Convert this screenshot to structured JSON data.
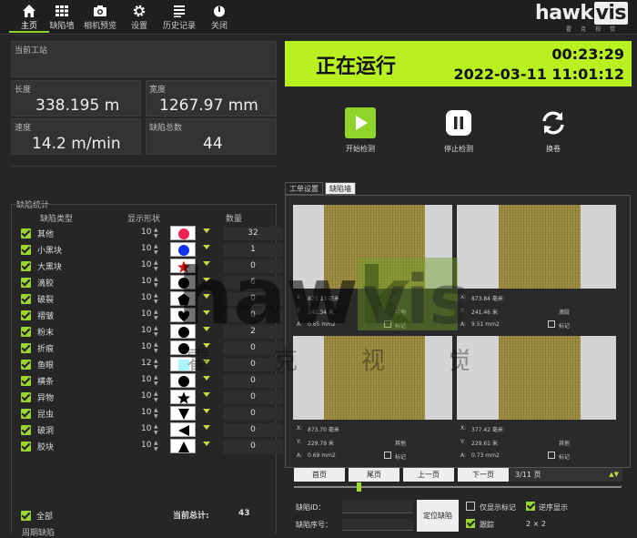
{
  "nav": {
    "items": [
      {
        "label": "主页",
        "icon": "home-icon"
      },
      {
        "label": "缺陷墙",
        "icon": "grid-icon"
      },
      {
        "label": "相机预览",
        "icon": "camera-icon"
      },
      {
        "label": "设置",
        "icon": "gear-icon"
      },
      {
        "label": "历史记录",
        "icon": "list-icon"
      },
      {
        "label": "关闭",
        "icon": "power-icon"
      }
    ],
    "logo": "hawk",
    "logo_badge": "vis",
    "logo_sub": "霍克视觉"
  },
  "info": {
    "station_label": "当前工站",
    "length_label": "长度",
    "length_value": "338.195 m",
    "width_label": "宽度",
    "width_value": "1267.97 mm",
    "speed_label": "速度",
    "speed_value": "14.2 m/min",
    "defects_label": "缺陷总数",
    "defects_value": "44"
  },
  "stats": {
    "title": "缺陷统计",
    "col_type": "缺陷类型",
    "col_shape": "显示形状",
    "col_count": "数量",
    "rows": [
      {
        "name": "其他",
        "size": "10",
        "shape": "circle",
        "color": "#ee2255",
        "count": "32"
      },
      {
        "name": "小黑块",
        "size": "10",
        "shape": "circle",
        "color": "#1133ee",
        "count": "1"
      },
      {
        "name": "大黑块",
        "size": "10",
        "shape": "star",
        "color": "#dd1111",
        "count": "0"
      },
      {
        "name": "滴胶",
        "size": "10",
        "shape": "circle",
        "color": "#000000",
        "count": "6"
      },
      {
        "name": "破裂",
        "size": "10",
        "shape": "pentagon",
        "color": "#000000",
        "count": "0"
      },
      {
        "name": "褶皱",
        "size": "10",
        "shape": "heart",
        "color": "#000000",
        "count": "0"
      },
      {
        "name": "粉末",
        "size": "10",
        "shape": "circle",
        "color": "#000000",
        "count": "2"
      },
      {
        "name": "折痕",
        "size": "10",
        "shape": "circle",
        "color": "#000000",
        "count": "0"
      },
      {
        "name": "鱼眼",
        "size": "12",
        "shape": "square",
        "color": "#aaf5ff",
        "count": "0"
      },
      {
        "name": "横条",
        "size": "10",
        "shape": "circle",
        "color": "#000000",
        "count": "0"
      },
      {
        "name": "异物",
        "size": "10",
        "shape": "star",
        "color": "#000000",
        "count": "0"
      },
      {
        "name": "昆虫",
        "size": "10",
        "shape": "triangle-down",
        "color": "#000000",
        "count": "0"
      },
      {
        "name": "破洞",
        "size": "10",
        "shape": "triangle-left",
        "color": "#000000",
        "count": "0"
      },
      {
        "name": "胶块",
        "size": "10",
        "shape": "triangle-up",
        "color": "#000000",
        "count": "0"
      }
    ],
    "all_label": "全部",
    "total_label": "当前总计:",
    "total_value": "43",
    "bottom_label": "周期缺陷"
  },
  "status": {
    "text": "正在运行",
    "timer": "00:23:29",
    "datetime": "2022-03-11 11:01:12"
  },
  "controls": {
    "start": "开始检测",
    "stop": "停止检测",
    "swap": "换卷"
  },
  "tabs": {
    "work": "工单设置",
    "wall": "缺陷墙"
  },
  "cells": [
    {
      "x": "873.13 毫米",
      "y": "242.34 米",
      "a": "0.65 mm2",
      "type": "其他",
      "mark": "标记"
    },
    {
      "x": "873.84 毫米",
      "y": "241.46 米",
      "a": "9.51 mm2",
      "type": "滴胶",
      "mark": "标记"
    },
    {
      "x": "873.70 毫米",
      "y": "229.79 米",
      "a": "0.69 mm2",
      "type": "其他",
      "mark": "标记"
    },
    {
      "x": "377.42 毫米",
      "y": "229.61 米",
      "a": "0.73 mm2",
      "type": "其他",
      "mark": "标记"
    }
  ],
  "cell_labels": {
    "x": "X:",
    "y": "Y:",
    "a": "A:"
  },
  "paging": {
    "first": "首页",
    "last": "尾页",
    "prev": "上一页",
    "next": "下一页",
    "info": "3/11 页"
  },
  "bottom": {
    "defect_id_label": "缺陷ID：",
    "defect_no_label": "缺陷序号：",
    "locate": "定位缺陷",
    "only_marked": "仅显示标记",
    "reverse": "逆序显示",
    "follow": "跟踪",
    "layout": "2 × 2"
  },
  "colors": {
    "accent": "#b8f020",
    "bg": "#262626"
  }
}
